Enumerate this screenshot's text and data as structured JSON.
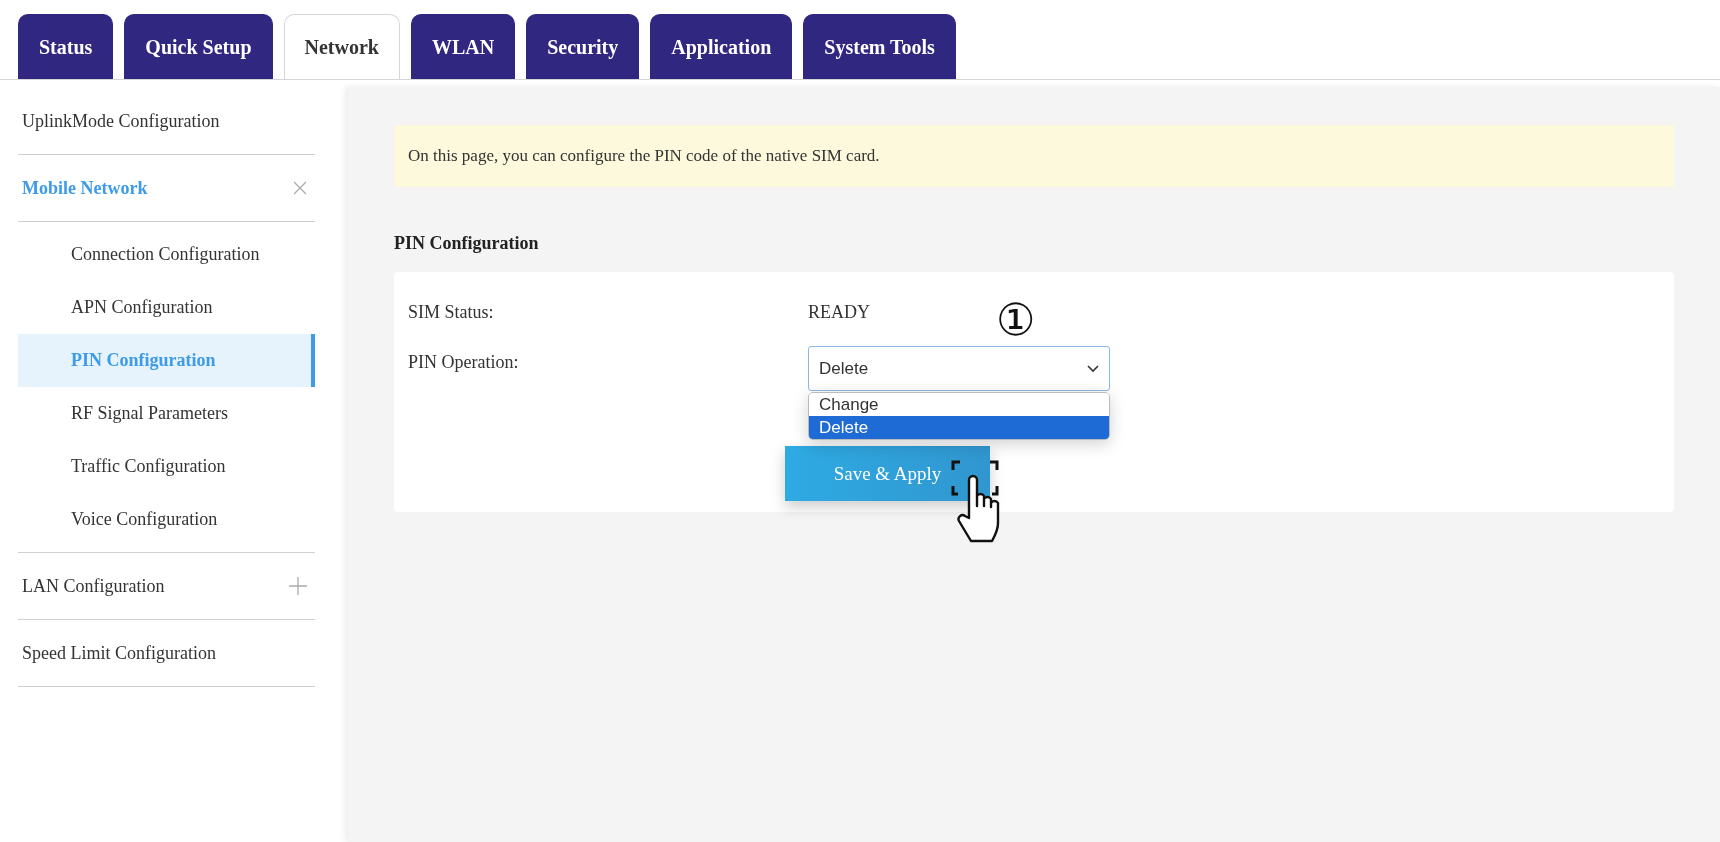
{
  "tabs": [
    {
      "label": "Status",
      "selected": false
    },
    {
      "label": "Quick Setup",
      "selected": false
    },
    {
      "label": "Network",
      "selected": true
    },
    {
      "label": "WLAN",
      "selected": false
    },
    {
      "label": "Security",
      "selected": false
    },
    {
      "label": "Application",
      "selected": false
    },
    {
      "label": "System Tools",
      "selected": false
    }
  ],
  "sidebar": {
    "items": [
      {
        "label": "UplinkMode Configuration",
        "selected": false
      },
      {
        "label": "Mobile Network",
        "kind": "group",
        "expanded": true,
        "children": [
          {
            "label": "Connection Configuration",
            "selected": false
          },
          {
            "label": "APN Configuration",
            "selected": false
          },
          {
            "label": "PIN Configuration",
            "selected": true
          },
          {
            "label": "RF Signal Parameters",
            "selected": false
          },
          {
            "label": "Traffic Configuration",
            "selected": false
          },
          {
            "label": "Voice Configuration",
            "selected": false
          }
        ]
      },
      {
        "label": "LAN Configuration",
        "kind": "group",
        "expanded": false
      },
      {
        "label": "Speed Limit Configuration",
        "selected": false
      }
    ]
  },
  "notice": "On this page, you can configure the PIN code of the native SIM card.",
  "section_title": "PIN Configuration",
  "fields": [
    {
      "kind": "text",
      "label": "SIM Status:",
      "value": "READY"
    },
    {
      "kind": "select",
      "label": "PIN Operation:",
      "value": "Delete",
      "expanded": true,
      "options": [
        {
          "label": "Change",
          "selected": false
        },
        {
          "label": "Delete",
          "selected": true
        }
      ]
    }
  ],
  "button": "Save & Apply",
  "annotation": "①"
}
